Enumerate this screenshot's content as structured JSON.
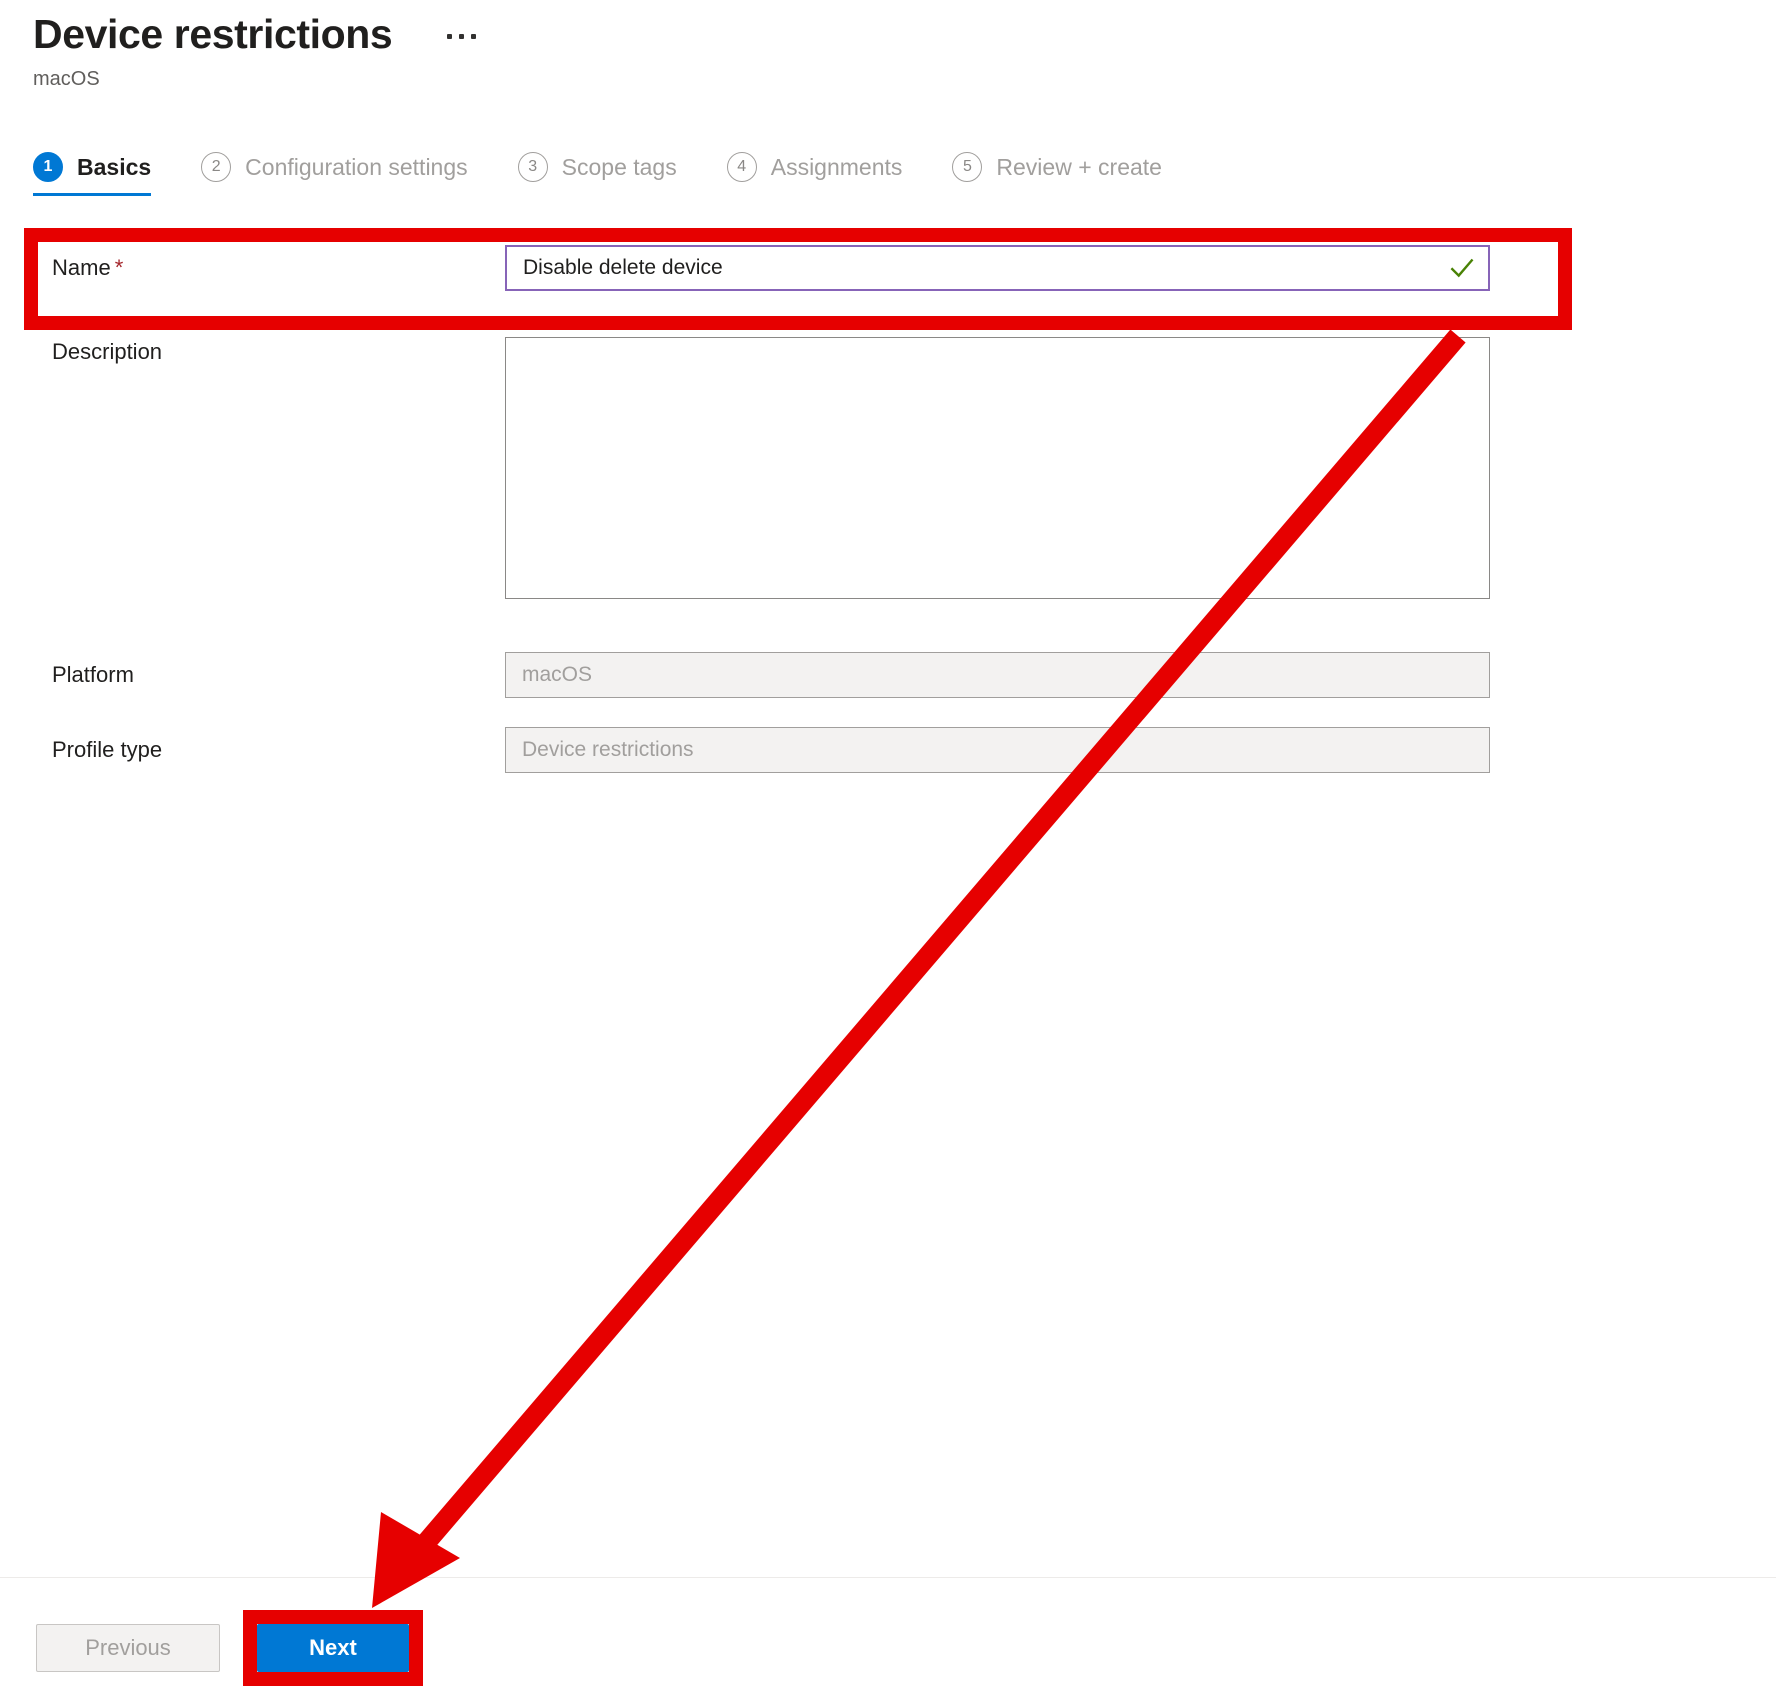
{
  "header": {
    "title": "Device restrictions",
    "subtitle": "macOS",
    "more_menu": "more-options"
  },
  "wizard": {
    "tabs": [
      {
        "number": "1",
        "label": "Basics",
        "active": true
      },
      {
        "number": "2",
        "label": "Configuration settings",
        "active": false
      },
      {
        "number": "3",
        "label": "Scope tags",
        "active": false
      },
      {
        "number": "4",
        "label": "Assignments",
        "active": false
      },
      {
        "number": "5",
        "label": "Review + create",
        "active": false
      }
    ]
  },
  "form": {
    "name": {
      "label": "Name",
      "required_marker": "*",
      "value": "Disable delete device",
      "placeholder": "",
      "validation_icon": "checkmark-icon",
      "validation_color": "#498205",
      "focus_border_color": "#8764b8"
    },
    "description": {
      "label": "Description",
      "value": "",
      "placeholder": ""
    },
    "platform": {
      "label": "Platform",
      "value": "macOS",
      "disabled": true
    },
    "profile_type": {
      "label": "Profile type",
      "value": "Device restrictions",
      "disabled": true
    }
  },
  "footer": {
    "previous_label": "Previous",
    "next_label": "Next"
  },
  "annotations": {
    "highlight_color": "#e60000",
    "name_field_highlight": "name-field-highlight",
    "next_button_highlight": "next-button-highlight",
    "arrow": "arrow-pointing-to-next-button"
  },
  "colors": {
    "accent": "#0078d4",
    "annotation_red": "#e60000",
    "focus_purple": "#8764b8",
    "success_green": "#498205",
    "disabled_bg": "#f3f2f1",
    "muted_text": "#a19f9d"
  }
}
